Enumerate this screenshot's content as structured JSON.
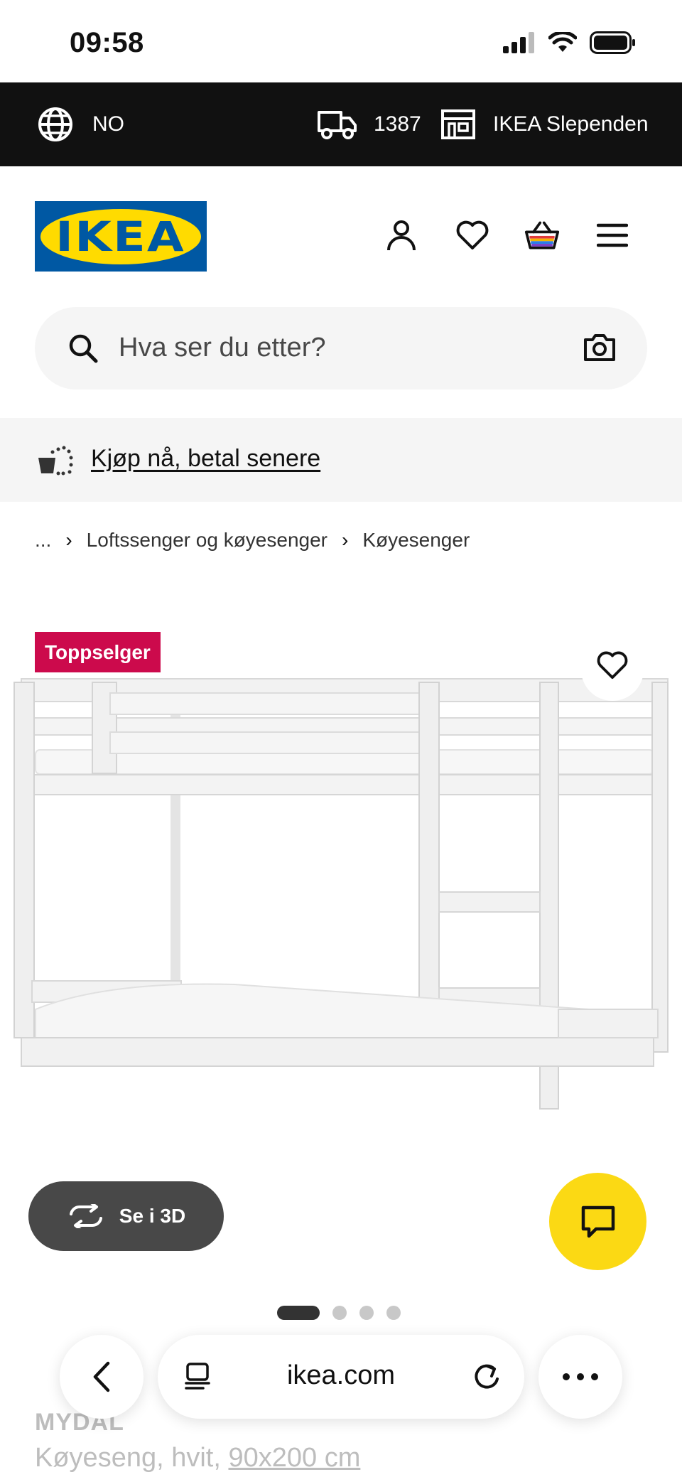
{
  "status_bar": {
    "time": "09:58"
  },
  "top_bar": {
    "country": "NO",
    "delivery_code": "1387",
    "store": "IKEA Slependen"
  },
  "header": {
    "logo_text": "IKEA"
  },
  "search": {
    "placeholder": "Hva ser du etter?"
  },
  "banner": {
    "link": "Kjøp nå, betal senere"
  },
  "breadcrumb": {
    "ellipsis": "...",
    "items": [
      "Loftssenger og køyesenger",
      "Køyesenger"
    ]
  },
  "product": {
    "badge": "Toppselger",
    "view_3d_label": "Se i 3D",
    "name": "MYDAL",
    "description": "Køyeseng, hvit, ",
    "size": "90x200 cm",
    "gallery_total": 4,
    "gallery_active": 1
  },
  "browser": {
    "url": "ikea.com"
  },
  "colors": {
    "badge": "#cc0a4c",
    "chat": "#fbd914",
    "logo_blue": "#0058a3",
    "logo_yellow": "#ffdb00"
  }
}
